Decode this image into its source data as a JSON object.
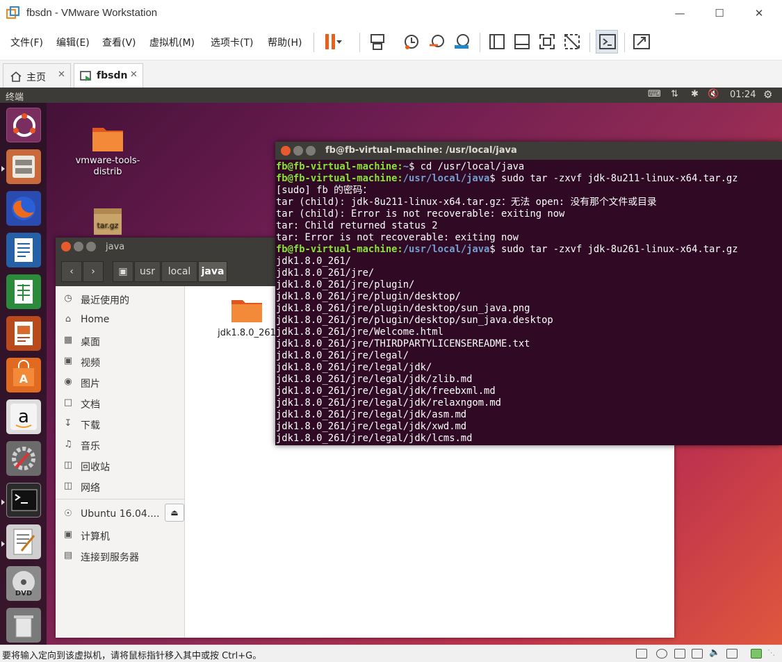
{
  "window": {
    "title": "fbsdn - VMware Workstation"
  },
  "menubar": {
    "items": [
      "文件(F)",
      "编辑(E)",
      "查看(V)",
      "虚拟机(M)",
      "选项卡(T)",
      "帮助(H)"
    ]
  },
  "tabs": [
    {
      "label": "主页"
    },
    {
      "label": "fbsdn"
    }
  ],
  "guest": {
    "panel": {
      "app_name": "终端",
      "clock": "01:24"
    },
    "desktop_icons": [
      {
        "label": "vmware-tools-\ndistrib"
      },
      {
        "label": "tar.gz"
      }
    ],
    "file_manager": {
      "title": "java",
      "breadcrumb": [
        "usr",
        "local",
        "java"
      ],
      "sidebar": [
        {
          "label": "最近使用的",
          "icon": "clock-icon"
        },
        {
          "label": "Home",
          "icon": "home-icon"
        },
        {
          "label": "桌面",
          "icon": "folder-icon"
        },
        {
          "label": "视频",
          "icon": "video-icon"
        },
        {
          "label": "图片",
          "icon": "camera-icon"
        },
        {
          "label": "文档",
          "icon": "document-icon"
        },
        {
          "label": "下载",
          "icon": "download-icon"
        },
        {
          "label": "音乐",
          "icon": "music-icon"
        },
        {
          "label": "回收站",
          "icon": "trash-icon"
        },
        {
          "label": "网络",
          "icon": "network-icon"
        },
        {
          "label": "Ubuntu 16.04....",
          "icon": "disc-icon"
        },
        {
          "label": "计算机",
          "icon": "computer-icon"
        },
        {
          "label": "连接到服务器",
          "icon": "server-icon"
        }
      ],
      "files": [
        {
          "name": "jdk1.8.0_261"
        }
      ]
    },
    "terminal": {
      "title": "fb@fb-virtual-machine: /usr/local/java",
      "prompt_user": "fb@fb-virtual-machine",
      "lines": [
        {
          "p": "~",
          "c": "$ cd /usr/local/java"
        },
        {
          "p": "/usr/local/java",
          "c": "$ sudo tar -zxvf jdk-8u211-linux-x64.tar.gz"
        },
        {
          "t": "[sudo] fb 的密码："
        },
        {
          "t": "tar (child): jdk-8u211-linux-x64.tar.gz：无法 open: 没有那个文件或目录"
        },
        {
          "t": "tar (child): Error is not recoverable: exiting now"
        },
        {
          "t": "tar: Child returned status 2"
        },
        {
          "t": "tar: Error is not recoverable: exiting now"
        },
        {
          "p": "/usr/local/java",
          "c": "$ sudo tar -zxvf jdk-8u261-linux-x64.tar.gz"
        },
        {
          "t": "jdk1.8.0_261/"
        },
        {
          "t": "jdk1.8.0_261/jre/"
        },
        {
          "t": "jdk1.8.0_261/jre/plugin/"
        },
        {
          "t": "jdk1.8.0_261/jre/plugin/desktop/"
        },
        {
          "t": "jdk1.8.0_261/jre/plugin/desktop/sun_java.png"
        },
        {
          "t": "jdk1.8.0_261/jre/plugin/desktop/sun_java.desktop"
        },
        {
          "t": "jdk1.8.0_261/jre/Welcome.html"
        },
        {
          "t": "jdk1.8.0_261/jre/THIRDPARTYLICENSEREADME.txt"
        },
        {
          "t": "jdk1.8.0_261/jre/legal/"
        },
        {
          "t": "jdk1.8.0_261/jre/legal/jdk/"
        },
        {
          "t": "jdk1.8.0_261/jre/legal/jdk/zlib.md"
        },
        {
          "t": "jdk1.8.0_261/jre/legal/jdk/freebxml.md"
        },
        {
          "t": "jdk1.8.0_261/jre/legal/jdk/relaxngom.md"
        },
        {
          "t": "jdk1.8.0_261/jre/legal/jdk/asm.md"
        },
        {
          "t": "jdk1.8.0_261/jre/legal/jdk/xwd.md"
        },
        {
          "t": "jdk1.8.0_261/jre/legal/jdk/lcms.md"
        }
      ]
    }
  },
  "statusbar": {
    "message": "要将输入定向到该虚拟机，请将鼠标指针移入其中或按 Ctrl+G。"
  },
  "colors": {
    "accent": "#e95420",
    "terminal_bg": "#300a24",
    "prompt_user": "#8ae234",
    "prompt_path": "#729fcf"
  }
}
